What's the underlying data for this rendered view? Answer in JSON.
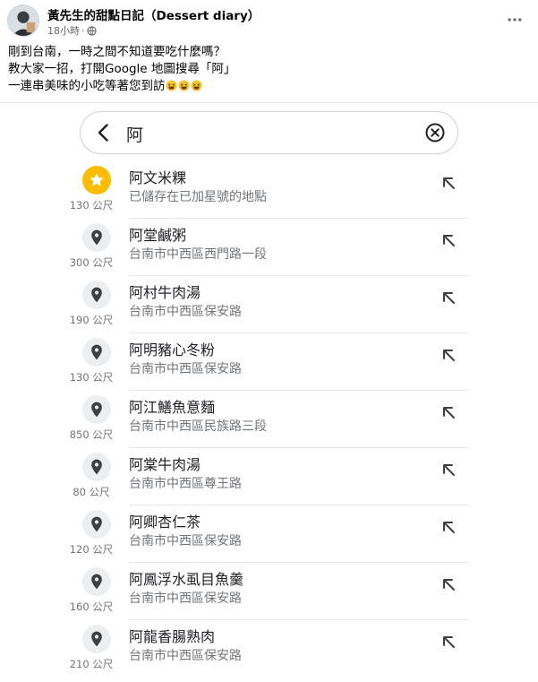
{
  "post": {
    "author": "黃先生的甜點日記（Dessert diary）",
    "time": "18小時",
    "separator": "·",
    "privacy_icon": "globe-icon",
    "more_icon": "more-horizontal-icon",
    "lines": [
      "剛到台南，一時之間不知道要吃什麼嗎？",
      "教大家一招，打開Google 地圖搜尋「阿」",
      "一連串美味的小吃等著您到訪"
    ],
    "emoji": [
      "grinning-squinting-face",
      "grinning-squinting-face",
      "grinning-squinting-face"
    ]
  },
  "search": {
    "back_icon": "arrow-back-icon",
    "value": "阿",
    "clear_icon": "clear-circle-icon"
  },
  "results": [
    {
      "name": "阿文米粿",
      "address": "已儲存在已加星號的地點",
      "distance": "130 公尺",
      "icon": "star-icon"
    },
    {
      "name": "阿堂鹹粥",
      "address": "台南市中西區西門路一段",
      "distance": "300 公尺",
      "icon": "location-pin-icon"
    },
    {
      "name": "阿村牛肉湯",
      "address": "台南市中西區保安路",
      "distance": "190 公尺",
      "icon": "location-pin-icon"
    },
    {
      "name": "阿明豬心冬粉",
      "address": "台南市中西區保安路",
      "distance": "130 公尺",
      "icon": "location-pin-icon"
    },
    {
      "name": "阿江鱔魚意麵",
      "address": "台南市中西區民族路三段",
      "distance": "850 公尺",
      "icon": "location-pin-icon"
    },
    {
      "name": "阿棠牛肉湯",
      "address": "台南市中西區尊王路",
      "distance": "80 公尺",
      "icon": "location-pin-icon"
    },
    {
      "name": "阿卿杏仁茶",
      "address": "台南市中西區保安路",
      "distance": "120 公尺",
      "icon": "location-pin-icon"
    },
    {
      "name": "阿鳳浮水虱目魚羹",
      "address": "台南市中西區保安路",
      "distance": "160 公尺",
      "icon": "location-pin-icon"
    },
    {
      "name": "阿龍香腸熟肉",
      "address": "台南市中西區保安路",
      "distance": "210 公尺",
      "icon": "location-pin-icon"
    }
  ],
  "colors": {
    "star": "#fbbc04",
    "pin_bg": "#eceff1",
    "secondary_text": "#70757a"
  }
}
